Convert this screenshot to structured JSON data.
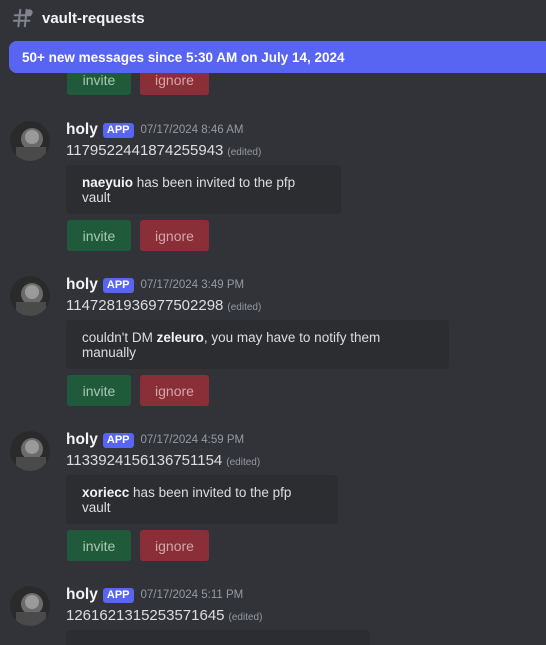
{
  "channel": {
    "name": "vault-requests",
    "icon": "threads-hash-icon"
  },
  "banner": {
    "text": "50+ new messages since 5:30 AM on July 14, 2024"
  },
  "buttons": {
    "invite": "invite",
    "ignore": "ignore"
  },
  "messages": [
    {
      "author": "holy",
      "badge": "APP",
      "timestamp": "07/17/2024 8:46 AM",
      "content": "1179522441874255943",
      "edited": "(edited)",
      "embed_bold": "naeyuio",
      "embed_text": " has been invited to the pfp vault"
    },
    {
      "author": "holy",
      "badge": "APP",
      "timestamp": "07/17/2024 3:49 PM",
      "content": "1147281936977502298",
      "edited": "(edited)",
      "embed_pre": "couldn't DM ",
      "embed_bold": "zeleuro",
      "embed_text": ", you may have to notify them manually"
    },
    {
      "author": "holy",
      "badge": "APP",
      "timestamp": "07/17/2024 4:59 PM",
      "content": "1133924156136751154",
      "edited": "(edited)",
      "embed_bold": "xoriecc",
      "embed_text": " has been invited to the pfp vault"
    },
    {
      "author": "holy",
      "badge": "APP",
      "timestamp": "07/17/2024 5:11 PM",
      "content": "1261621315253571645",
      "edited": "(edited)"
    }
  ]
}
